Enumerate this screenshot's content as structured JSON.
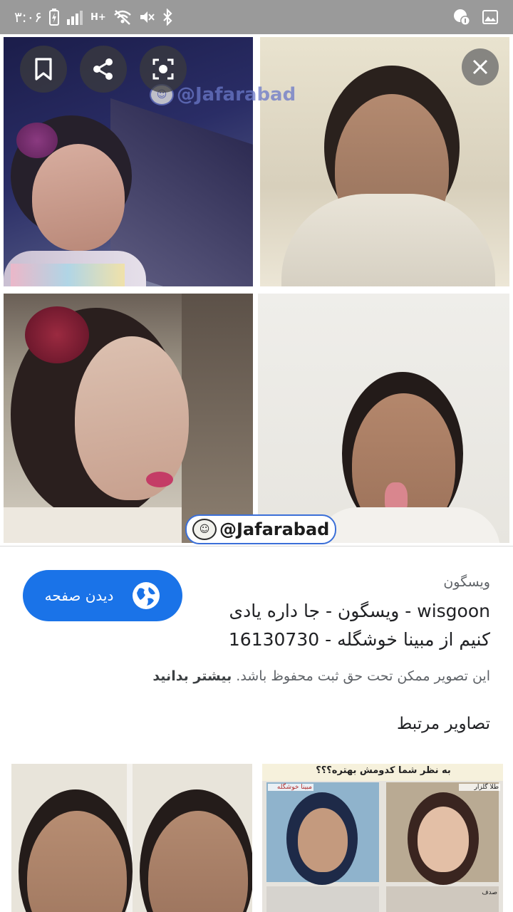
{
  "status_bar": {
    "time": "۳:۰۶",
    "signal_label": "H+"
  },
  "viewer": {
    "watermark_top": "@Jafarabad",
    "watermark_bottom": "@Jafarabad"
  },
  "info": {
    "visit_button_label": "دیدن صفحه",
    "site_name": "ویسگون",
    "title_line1": "wisgoon - ویسگون - جا داره یادی",
    "title_line2": "کنیم از مبینا خوشگله - 16130730",
    "copyright_text": "این تصویر ممکن تحت حق ثبت محفوظ باشد.",
    "learn_more": "بیشتر بدانید",
    "related_heading": "تصاویر مرتبط"
  },
  "related": {
    "collage_caption": "به نظر شما کدومش بهتره؟؟؟",
    "label_left": "مبینا خوشگله",
    "label_right": "طلا گلزار",
    "label_bottom_right": "صدف"
  },
  "colors": {
    "accent": "#1a73e8",
    "status_bar": "#9a9a9a"
  }
}
